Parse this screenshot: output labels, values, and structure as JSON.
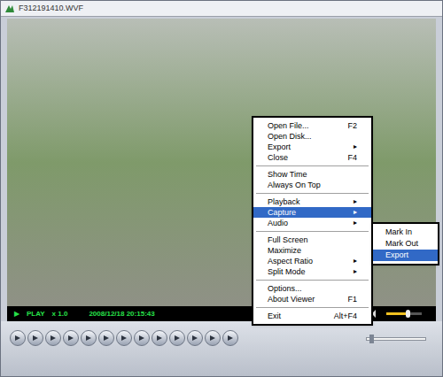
{
  "window": {
    "title": "F312191410.WVF"
  },
  "status_bar": {
    "play_icon": "▶",
    "state": "PLAY",
    "speed": "x 1.0",
    "timestamp": "2008/12/18 20:15:43",
    "volume": {
      "level": 0.6
    }
  },
  "seek": {
    "level": 0.05
  },
  "context_menu": {
    "submenu_arrow": "▸",
    "items": [
      {
        "kind": "item",
        "label": "Open File...",
        "shortcut": "F2",
        "submenu": false,
        "selected": false
      },
      {
        "kind": "item",
        "label": "Open Disk...",
        "shortcut": "",
        "submenu": false,
        "selected": false
      },
      {
        "kind": "item",
        "label": "Export",
        "shortcut": "",
        "submenu": true,
        "selected": false
      },
      {
        "kind": "item",
        "label": "Close",
        "shortcut": "F4",
        "submenu": false,
        "selected": false
      },
      {
        "kind": "separator"
      },
      {
        "kind": "item",
        "label": "Show Time",
        "shortcut": "",
        "submenu": false,
        "selected": false
      },
      {
        "kind": "item",
        "label": "Always On Top",
        "shortcut": "",
        "submenu": false,
        "selected": false
      },
      {
        "kind": "separator"
      },
      {
        "kind": "item",
        "label": "Playback",
        "shortcut": "",
        "submenu": true,
        "selected": false
      },
      {
        "kind": "item",
        "label": "Capture",
        "shortcut": "",
        "submenu": true,
        "selected": true
      },
      {
        "kind": "item",
        "label": "Audio",
        "shortcut": "",
        "submenu": true,
        "selected": false
      },
      {
        "kind": "separator"
      },
      {
        "kind": "item",
        "label": "Full Screen",
        "shortcut": "",
        "submenu": false,
        "selected": false
      },
      {
        "kind": "item",
        "label": "Maximize",
        "shortcut": "",
        "submenu": false,
        "selected": false
      },
      {
        "kind": "item",
        "label": "Aspect Ratio",
        "shortcut": "",
        "submenu": true,
        "selected": false
      },
      {
        "kind": "item",
        "label": "Split Mode",
        "shortcut": "",
        "submenu": true,
        "selected": false
      },
      {
        "kind": "separator"
      },
      {
        "kind": "item",
        "label": "Options...",
        "shortcut": "",
        "submenu": false,
        "selected": false
      },
      {
        "kind": "item",
        "label": "About Viewer",
        "shortcut": "F1",
        "submenu": false,
        "selected": false
      },
      {
        "kind": "separator"
      },
      {
        "kind": "item",
        "label": "Exit",
        "shortcut": "Alt+F4",
        "submenu": false,
        "selected": false
      }
    ]
  },
  "submenu": {
    "items": [
      {
        "label": "Mark In",
        "selected": false
      },
      {
        "label": "Mark Out",
        "selected": false
      },
      {
        "label": "Export",
        "selected": true
      }
    ]
  }
}
